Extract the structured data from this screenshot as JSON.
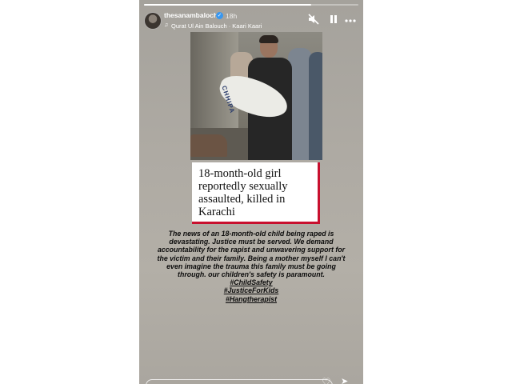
{
  "story": {
    "progress": 0.78,
    "username": "thesanambaloch",
    "time_ago": "18h",
    "music": "Qurat Ul Ain Balouch · Kaari Kaari",
    "icons": {
      "verified": "verified-badge-icon",
      "mute": "speaker-muted-icon",
      "pause": "pause-icon",
      "more": "more-options-icon",
      "music": "music-note-icon",
      "heart": "heart-icon",
      "share": "send-icon"
    }
  },
  "news": {
    "photo_text": "CHHIPA",
    "headline": "18-month-old girl reportedly sexually assaulted, killed in Karachi",
    "accent_color": "#c8102e"
  },
  "caption": {
    "body": "The news of an 18-month-old child being raped is devastating. Justice must be served. We demand accountability for the rapist and unwavering support for the victim and their family. Being a mother myself I can't even imagine the trauma this family must be going through. our children's safety is paramount.",
    "hashtags": [
      "#ChildSafety",
      "#JusticeForKids",
      "#Hangtherapist"
    ]
  }
}
